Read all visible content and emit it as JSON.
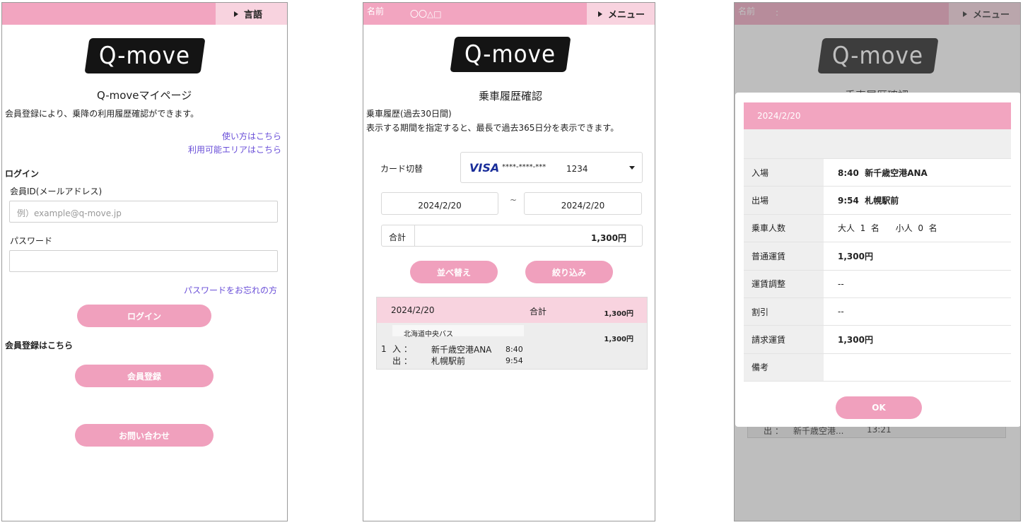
{
  "screen1": {
    "lang_button": "言語",
    "logo": "Q-move",
    "title": "Q-moveマイページ",
    "description": "会員登録により、乗降の利用履歴確認ができます。",
    "link_usage": "使い方はこちら",
    "link_area": "利用可能エリアはこちら",
    "login_heading": "ログイン",
    "member_id_label": "会員ID(メールアドレス)",
    "member_id_placeholder": "例）example@q-move.jp",
    "password_label": "パスワード",
    "forgot_password": "パスワードをお忘れの方",
    "login_button": "ログイン",
    "register_heading": "会員登録はこちら",
    "register_button": "会員登録",
    "contact_button": "お問い合わせ"
  },
  "screen2": {
    "name_label": "名前",
    "name_value": "〇〇△□",
    "menu_button": "メニュー",
    "logo": "Q-move",
    "title": "乗車履歴確認",
    "desc_line1": "乗車履歴(過去30日間)",
    "desc_line2": "表示する期間を指定すると、最長で過去365日分を表示できます。",
    "card_switch_label": "カード切替",
    "card_brand": "VISA",
    "card_mask": "****-****-***",
    "card_last4": "1234",
    "date_from": "2024/2/20",
    "date_sep": "~",
    "date_to": "2024/2/20",
    "total_label": "合計",
    "total_value": "1,300円",
    "sort_button": "並べ替え",
    "filter_button": "絞り込み",
    "list_header": {
      "date": "2024/2/20",
      "total_label": "合計",
      "total_value": "1,300円"
    },
    "trip": {
      "index": "1",
      "operator": "北海道中央バス",
      "in_label": "入 ：",
      "in_stop": "新千歳空港ANA",
      "in_time": "8:40",
      "out_label": "出 ：",
      "out_stop": "札幌駅前",
      "out_time": "9:54",
      "fare": "1,300円"
    }
  },
  "screen3": {
    "name_label": "名前",
    "name_value": ":",
    "menu_button": "メニュー",
    "logo": "Q-move",
    "behind_title": "乗車履歴確認",
    "behind_row": {
      "label": "出 ：",
      "stop": "新千歳空港...",
      "time": "13:21"
    },
    "modal": {
      "date": "2024/2/20",
      "rows": [
        {
          "key": "入場",
          "value": "8:40  新千歳空港ANA"
        },
        {
          "key": "出場",
          "value": "9:54  札幌駅前"
        },
        {
          "key": "乗車人数",
          "value": "大人  1  名      小人  0  名"
        },
        {
          "key": "普通運賃",
          "value": "1,300円"
        },
        {
          "key": "運賃調整",
          "value": "--"
        },
        {
          "key": "割引",
          "value": "--"
        },
        {
          "key": "請求運賃",
          "value": "1,300円"
        },
        {
          "key": "備考",
          "value": ""
        }
      ],
      "ok_button": "OK"
    }
  },
  "colors": {
    "pink_bar": "#f2a5c0",
    "pink_light": "#f8d3df",
    "pink_button": "#f0a0bd",
    "link": "#6a4fd8"
  }
}
